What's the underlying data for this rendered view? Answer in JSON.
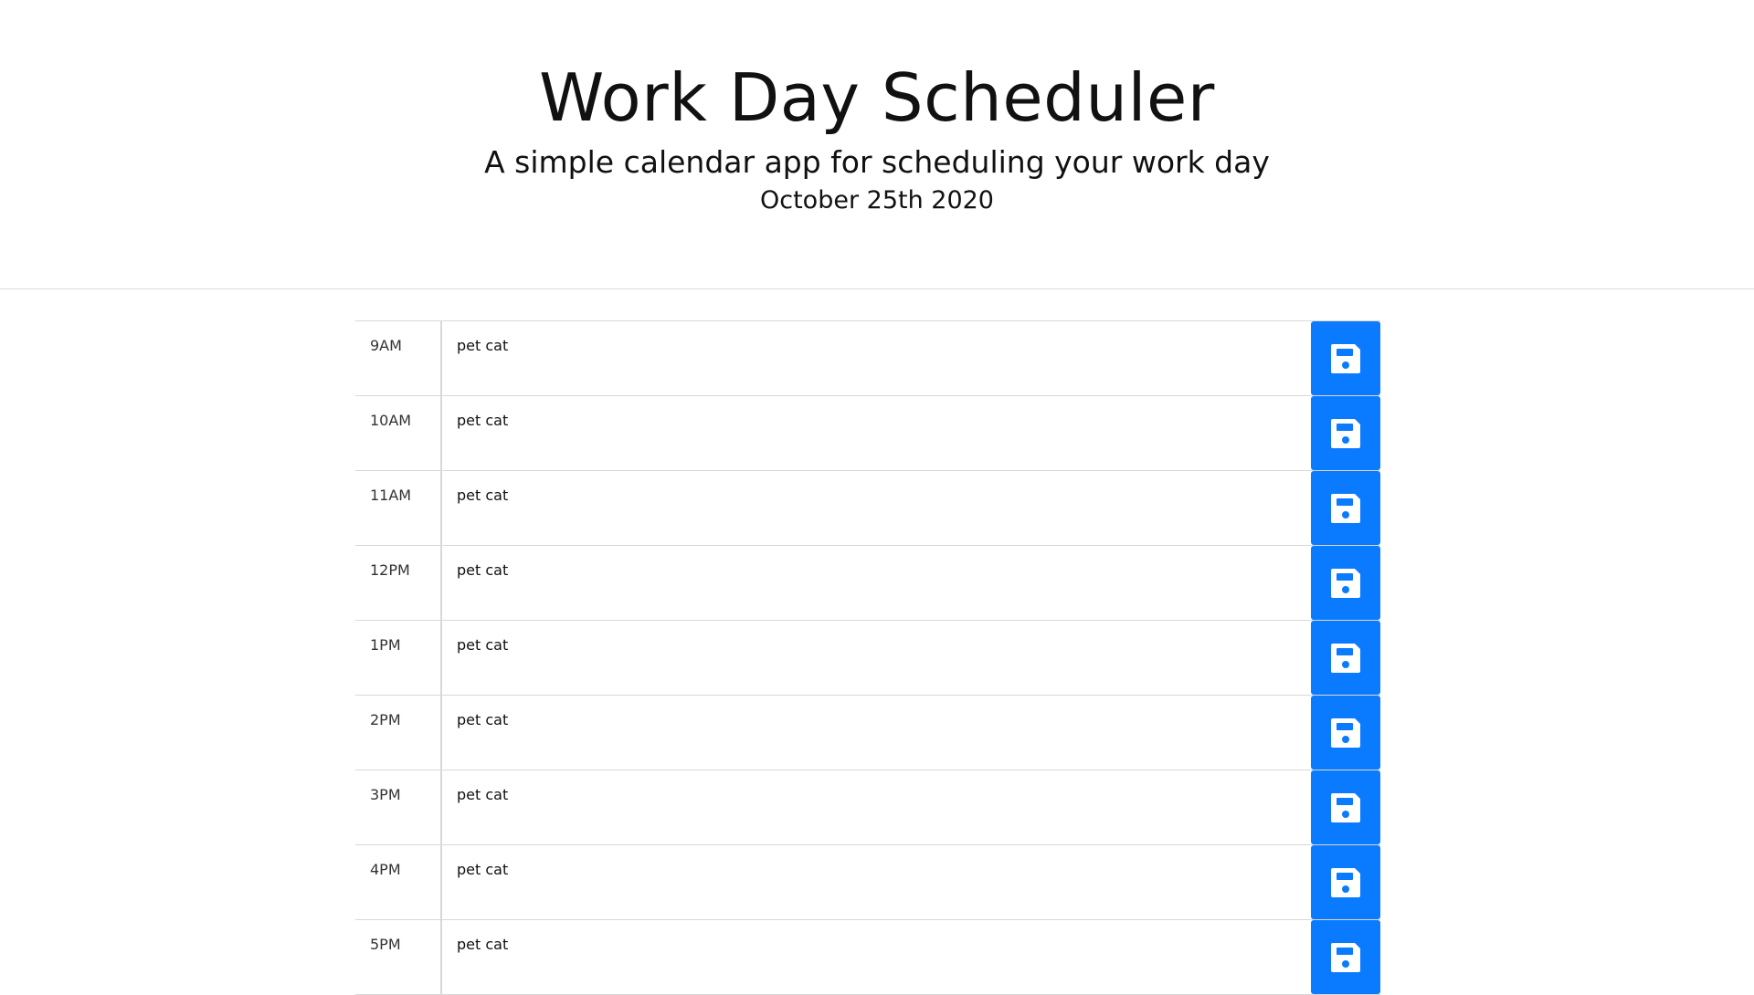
{
  "header": {
    "title": "Work Day Scheduler",
    "subtitle": "A simple calendar app for scheduling your work day",
    "date": "October 25th 2020"
  },
  "colors": {
    "save_button": "#0a7bff",
    "divider": "#d8d8d8"
  },
  "rows": [
    {
      "hour": "9AM",
      "text": "pet cat",
      "save_icon": "floppy-disk-icon"
    },
    {
      "hour": "10AM",
      "text": "pet cat",
      "save_icon": "floppy-disk-icon"
    },
    {
      "hour": "11AM",
      "text": "pet cat",
      "save_icon": "floppy-disk-icon"
    },
    {
      "hour": "12PM",
      "text": "pet cat",
      "save_icon": "floppy-disk-icon"
    },
    {
      "hour": "1PM",
      "text": "pet cat",
      "save_icon": "floppy-disk-icon"
    },
    {
      "hour": "2PM",
      "text": "pet cat",
      "save_icon": "floppy-disk-icon"
    },
    {
      "hour": "3PM",
      "text": "pet cat",
      "save_icon": "floppy-disk-icon"
    },
    {
      "hour": "4PM",
      "text": "pet cat",
      "save_icon": "floppy-disk-icon"
    },
    {
      "hour": "5PM",
      "text": "pet cat",
      "save_icon": "floppy-disk-icon"
    }
  ]
}
